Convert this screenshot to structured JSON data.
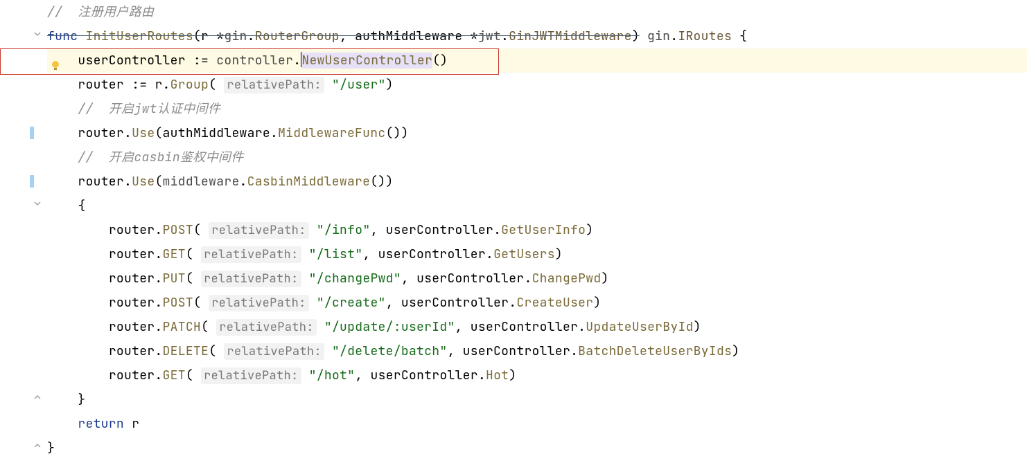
{
  "code": {
    "comment1": "//  注册用户路由",
    "func_kw": "func",
    "func_name": "InitUserRoutes",
    "param1_name": "r",
    "param1_star": "*",
    "param1_pkg": "gin",
    "param1_type": "RouterGroup",
    "param2_name": "authMiddleware",
    "param2_star": "*",
    "param2_pkg": "jwt",
    "param2_type": "GinJWTMiddleware",
    "ret_pkg": "gin",
    "ret_type": "IRoutes",
    "userController": "userController",
    "assign": ":=",
    "controller_pkg": "controller",
    "newUserController": "NewUserController",
    "router_var": "router",
    "r_var": "r",
    "group_method": "Group",
    "relativePath_hint": "relativePath:",
    "user_path": "\"/user\"",
    "comment_jwt": "//  开启jwt认证中间件",
    "use_method": "Use",
    "authMid_var": "authMiddleware",
    "middlewareFunc": "MiddlewareFunc",
    "comment_casbin": "//  开启casbin鉴权中间件",
    "middleware_pkg": "middleware",
    "casbinMiddleware": "CasbinMiddleware",
    "post_method": "POST",
    "get_method": "GET",
    "put_method": "PUT",
    "patch_method": "PATCH",
    "delete_method": "DELETE",
    "info_path": "\"/info\"",
    "list_path": "\"/list\"",
    "changePwd_path": "\"/changePwd\"",
    "create_path": "\"/create\"",
    "update_path": "\"/update/:userId\"",
    "delete_path": "\"/delete/batch\"",
    "hot_path": "\"/hot\"",
    "getUserInfo": "GetUserInfo",
    "getUsers": "GetUsers",
    "changePwd": "ChangePwd",
    "createUser": "CreateUser",
    "updateUserById": "UpdateUserById",
    "batchDeleteUserByIds": "BatchDeleteUserByIds",
    "hot_method": "Hot",
    "return_kw": "return"
  }
}
